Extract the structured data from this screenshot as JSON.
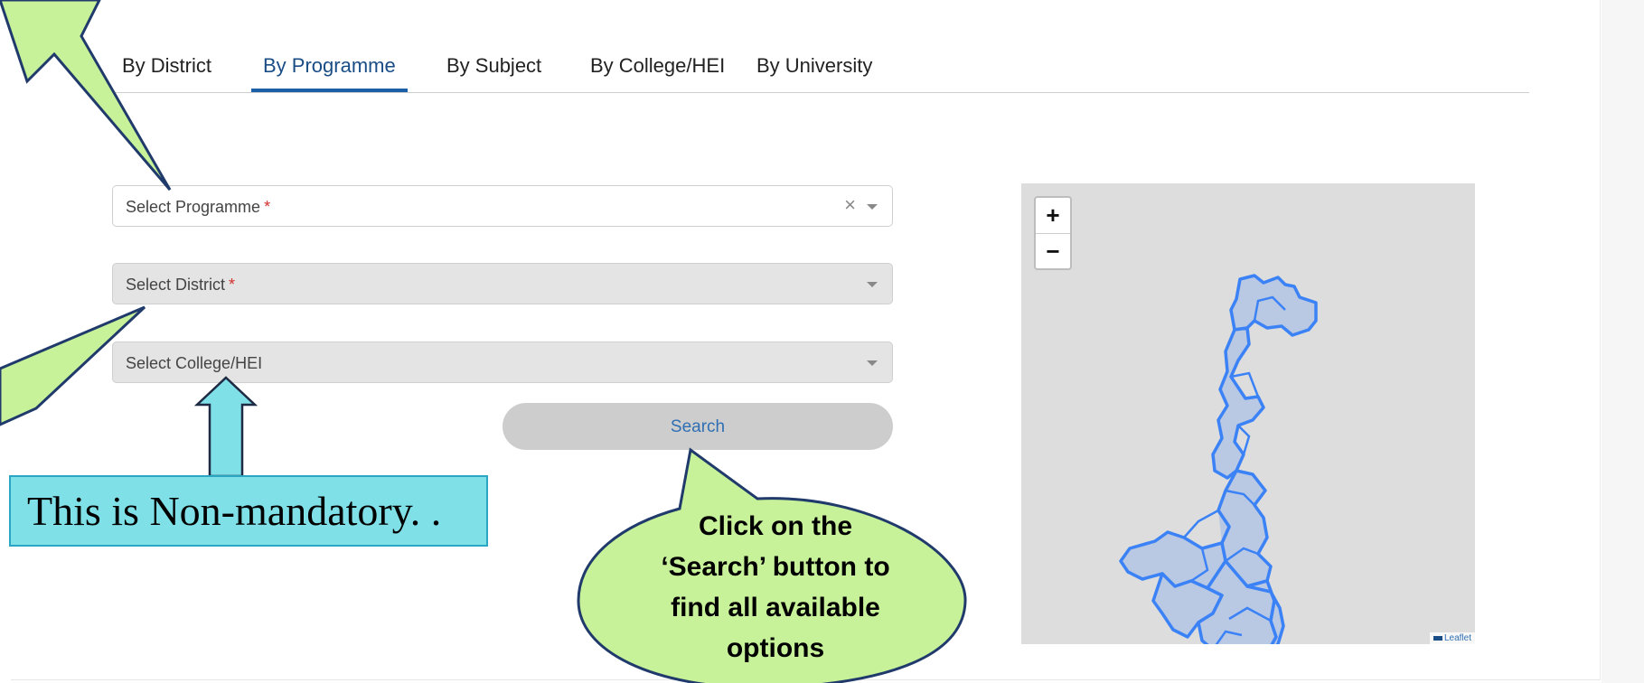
{
  "tabs": [
    {
      "label": "By District",
      "active": false
    },
    {
      "label": "By Programme",
      "active": true
    },
    {
      "label": "By Subject",
      "active": false
    },
    {
      "label": "By College/HEI",
      "active": false
    },
    {
      "label": "By University",
      "active": false
    }
  ],
  "form": {
    "programme": {
      "placeholder": "Select Programme",
      "required_mark": "*",
      "clear": "×"
    },
    "district": {
      "placeholder": "Select District",
      "required_mark": "*"
    },
    "college": {
      "placeholder": "Select College/HEI"
    },
    "search_label": "Search"
  },
  "map": {
    "zoom_in": "+",
    "zoom_out": "−",
    "attribution": "Leaflet",
    "boundary_color": "#3b82f6",
    "fill_color": "#b9c8e3"
  },
  "annotations": {
    "non_mandatory": "This is Non-mandatory. .",
    "search_callout": "Click on the ‘Search’ button to find all available options"
  },
  "colors": {
    "accent": "#1a5fa8",
    "callout_fill": "#c8f29a",
    "note_fill": "#80e0e8"
  }
}
